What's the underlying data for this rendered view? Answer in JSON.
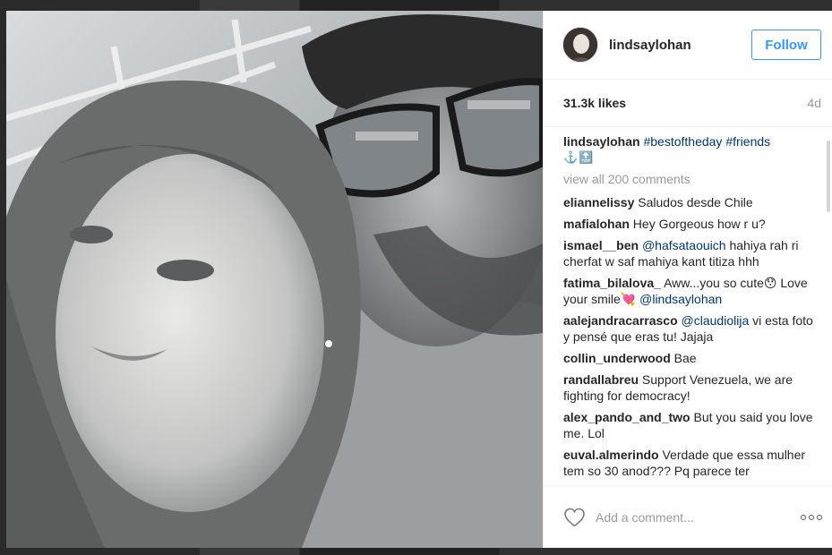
{
  "post": {
    "username": "lindsaylohan",
    "follow_label": "Follow",
    "likes": "31.3k likes",
    "age": "4d",
    "caption": {
      "user": "lindsaylohan",
      "tag1": "#bestoftheday",
      "tag2": "#friends",
      "glyphs": "⚓️🔝"
    },
    "view_all_label": "view all 200 comments",
    "comments": [
      {
        "user": "eliannelissy",
        "text": "Saludos desde Chile"
      },
      {
        "user": "mafialohan",
        "text": "Hey Gorgeous how r u?"
      },
      {
        "user": "ismael__ben",
        "mention": "@hafsataouich",
        "text": " hahiya rah ri cherfat w saf mahiya kant titiza hhh"
      },
      {
        "user": "fatima_bilalova_",
        "text": "Aww...you so cute😯 Love your smile💘 ",
        "mention": "@lindsaylohan"
      },
      {
        "user": "aalejandracarrasco",
        "mention": "@claudiolija",
        "text": " vi esta foto y pensé que eras tu! Jajaja"
      },
      {
        "user": "collin_underwood",
        "text": "Bae"
      },
      {
        "user": "randallabreu",
        "text": "Support Venezuela, we are fighting for democracy!"
      },
      {
        "user": "alex_pando_and_two",
        "text": "But you said you love me. Lol"
      },
      {
        "user": "euval.almerindo",
        "text": "Verdade que essa mulher tem so 30 anod??? Pq parece ter"
      }
    ],
    "comment_placeholder": "Add a comment...",
    "icons": {
      "heart": "heart-icon",
      "more": "more-options-icon"
    }
  },
  "colors": {
    "accent": "#3897f0",
    "hashtag": "#003569",
    "muted": "#999999",
    "text": "#262626"
  }
}
